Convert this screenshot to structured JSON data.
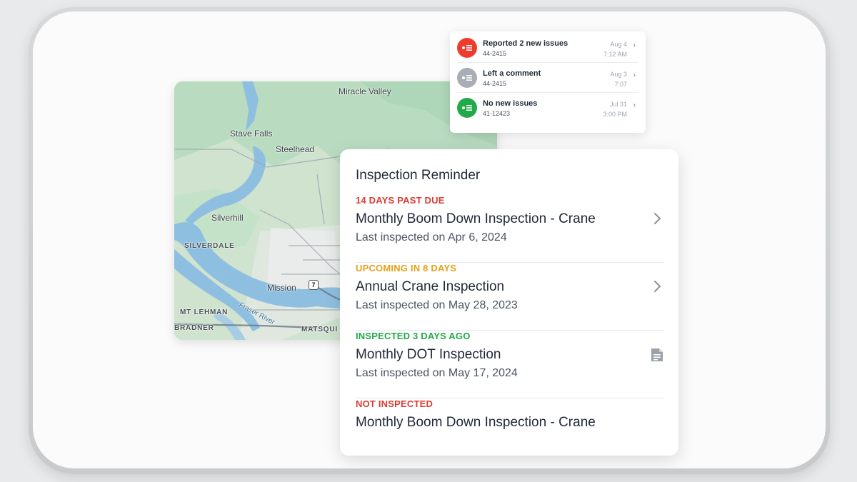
{
  "map": {
    "places": [
      {
        "name": "Miracle Valley",
        "style": "normal"
      },
      {
        "name": "Stave Falls",
        "style": "normal"
      },
      {
        "name": "Steelhead",
        "style": "normal"
      },
      {
        "name": "Silverhill",
        "style": "normal"
      },
      {
        "name": "SILVERDALE",
        "style": "caps"
      },
      {
        "name": "Mission",
        "style": "normal"
      },
      {
        "name": "MT LEHMAN",
        "style": "caps"
      },
      {
        "name": "Fraser River",
        "style": "river"
      },
      {
        "name": "BRADNER",
        "style": "caps"
      },
      {
        "name": "MATSQUI",
        "style": "caps"
      }
    ],
    "highway_label": "7"
  },
  "activity": {
    "items": [
      {
        "title": "Reported 2 new issues",
        "sub": "44-2415",
        "date": "Aug 4",
        "time": "7:12 AM",
        "color": "#ef3b2d"
      },
      {
        "title": "Left a comment",
        "sub": "44-2415",
        "date": "Aug 3",
        "time": "7:07",
        "color": "#a9adb6"
      },
      {
        "title": "No new issues",
        "sub": "41-12423",
        "date": "Jul 31",
        "time": "3:00 PM",
        "color": "#22a94a"
      }
    ]
  },
  "reminder": {
    "title": "Inspection Reminder",
    "items": [
      {
        "status": "14 DAYS PAST DUE",
        "status_color": "#dc3b32",
        "name": "Monthly Boom Down Inspection - Crane",
        "last": "Last inspected on Apr 6, 2024",
        "icon": "chevron-right-icon"
      },
      {
        "status": "UPCOMING IN 8 DAYS",
        "status_color": "#e7a11a",
        "name": "Annual Crane Inspection",
        "last": "Last inspected on May 28, 2023",
        "icon": "chevron-right-icon"
      },
      {
        "status": "INSPECTED 3 DAYS AGO",
        "status_color": "#22a94a",
        "name": "Monthly DOT Inspection",
        "last": "Last inspected on May 17, 2024",
        "icon": "document-icon"
      },
      {
        "status": "NOT INSPECTED",
        "status_color": "#dc3b32",
        "name": "Monthly Boom Down Inspection - Crane",
        "last": "",
        "icon": ""
      }
    ]
  }
}
